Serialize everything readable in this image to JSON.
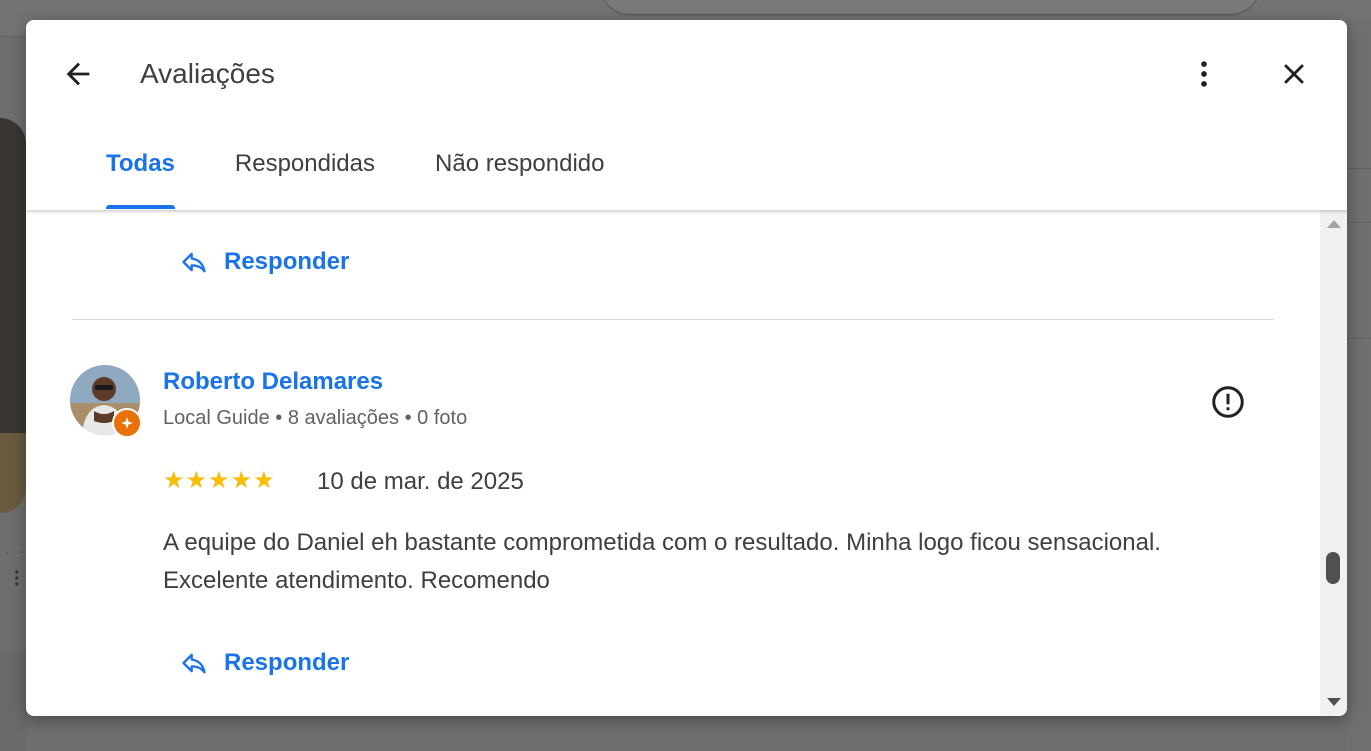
{
  "dialog": {
    "title": "Avaliações",
    "icons": {
      "back": "arrow-back-icon",
      "more": "more-vert-icon",
      "close": "close-icon"
    }
  },
  "tabs": [
    {
      "label": "Todas",
      "active": true
    },
    {
      "label": "Respondidas",
      "active": false
    },
    {
      "label": "Não respondido",
      "active": false
    }
  ],
  "reviews": [
    {
      "reply_label": "Responder"
    },
    {
      "reviewer": "Roberto Delamares",
      "meta": "Local Guide • 8 avaliações • 0 foto",
      "rating": 5,
      "stars": "★★★★★",
      "date": "10 de mar. de 2025",
      "text": "A equipe do Daniel eh bastante comprometida com o resultado. Minha logo ficou sensacional. Excelente atendimento. Recomendo",
      "reply_label": "Responder",
      "local_guide_badge": true
    }
  ],
  "colors": {
    "accent": "#1a73e8",
    "star": "#fbbc04",
    "badge": "#e8710a"
  }
}
